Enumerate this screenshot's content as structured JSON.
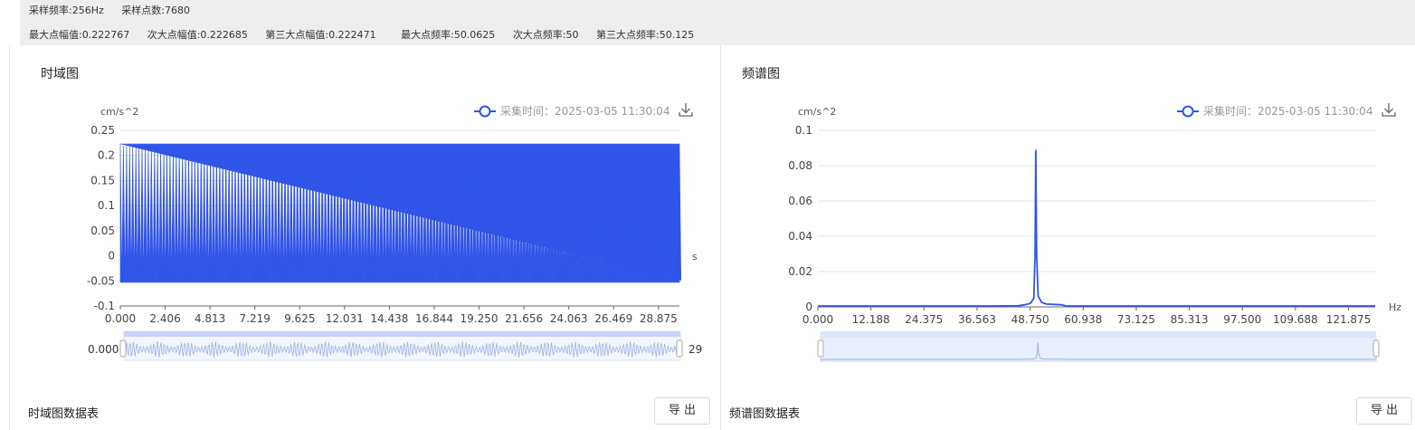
{
  "info": {
    "row1": [
      "采样频率:256Hz",
      "采样点数:7680"
    ],
    "row2": [
      "最大点幅值:0.222767",
      "次大点幅值:0.222685",
      "第三大点幅值:0.222471",
      "最大点频率:50.0625",
      "次大点频率:50",
      "第三大点频率:50.125"
    ]
  },
  "colors": {
    "series": "#3055e8",
    "grid": "#e6e6e6",
    "axis": "#666666",
    "zoom_fill": "#c7d4f7"
  },
  "time_panel": {
    "title": "时域图",
    "table_title": "时域图数据表",
    "export_label": "导 出",
    "legend": "采集时间：2025-03-05 11:30:04",
    "download_icon": "download-icon",
    "zoom_start_label": "0.000",
    "zoom_end_label": "29",
    "chart_data": {
      "type": "line",
      "ylabel": "cm/s^2",
      "xlabel": "s",
      "ylim": [
        -0.1,
        0.25
      ],
      "yticks": [
        "0.25",
        "0.2",
        "0.15",
        "0.1",
        "0.05",
        "0",
        "-0.05",
        "-0.1"
      ],
      "xticks": [
        "0.000",
        "2.406",
        "4.813",
        "7.219",
        "9.625",
        "12.031",
        "14.438",
        "16.844",
        "19.250",
        "21.656",
        "24.063",
        "26.469",
        "28.875"
      ],
      "xlim": [
        0,
        30
      ],
      "envelope_max": 0.2228,
      "envelope_min": -0.053,
      "grid": true,
      "legend_position": "top-right"
    }
  },
  "freq_panel": {
    "title": "频谱图",
    "table_title": "频谱图数据表",
    "export_label": "导 出",
    "legend": "采集时间：2025-03-05 11:30:04",
    "download_icon": "download-icon",
    "chart_data": {
      "type": "line",
      "ylabel": "cm/s^2",
      "xlabel": "Hz",
      "ylim": [
        0,
        0.1
      ],
      "yticks": [
        "0.1",
        "0.08",
        "0.06",
        "0.04",
        "0.02",
        "0"
      ],
      "xticks": [
        "0.000",
        "12.188",
        "24.375",
        "36.563",
        "48.750",
        "60.938",
        "73.125",
        "85.313",
        "97.500",
        "109.688",
        "121.875"
      ],
      "xlim": [
        0,
        128
      ],
      "peak": {
        "x": 50.0625,
        "y": 0.089
      },
      "grid": true,
      "legend_position": "top-right"
    }
  }
}
